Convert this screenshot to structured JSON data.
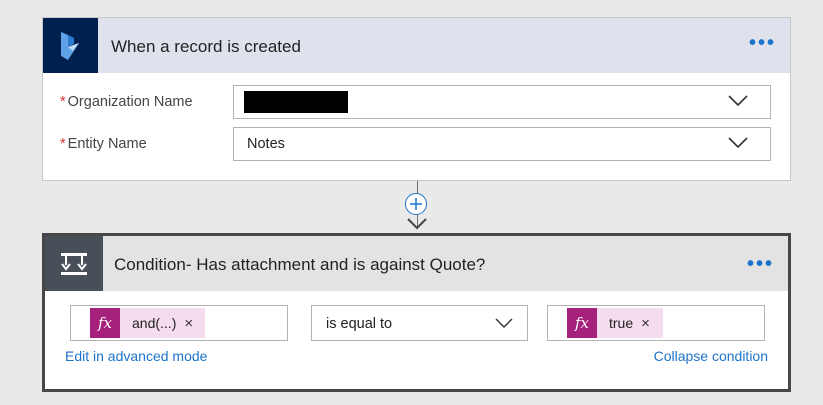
{
  "trigger": {
    "title": "When a record is created",
    "more_label": "•••",
    "fields": {
      "organization": {
        "label": "Organization Name",
        "required": "*",
        "value": ""
      },
      "entity": {
        "label": "Entity Name",
        "required": "*",
        "value": "Notes"
      }
    }
  },
  "connector": {
    "add_label": "+"
  },
  "condition": {
    "title": "Condition- Has attachment and is against Quote?",
    "more_label": "•••",
    "left_token": {
      "fx": "fx",
      "text": "and(...)",
      "remove": "×"
    },
    "operator": "is equal to",
    "right_token": {
      "fx": "fx",
      "text": "true",
      "remove": "×"
    },
    "edit_advanced_label": "Edit in advanced mode",
    "collapse_label": "Collapse condition"
  },
  "colors": {
    "accent": "#1d73c9",
    "trigger_header": "#dfe2ec",
    "dynamics_logo_bg": "#002050",
    "condition_icon_bg": "#484f58",
    "fx_badge": "#a6217c",
    "token_bg": "#f5dcef",
    "required": "#d13438"
  },
  "icons": {
    "trigger_logo": "dynamics-365-icon",
    "condition_logo": "condition-icon",
    "dropdown": "chevron-down-icon",
    "add": "plus-circle-icon"
  }
}
